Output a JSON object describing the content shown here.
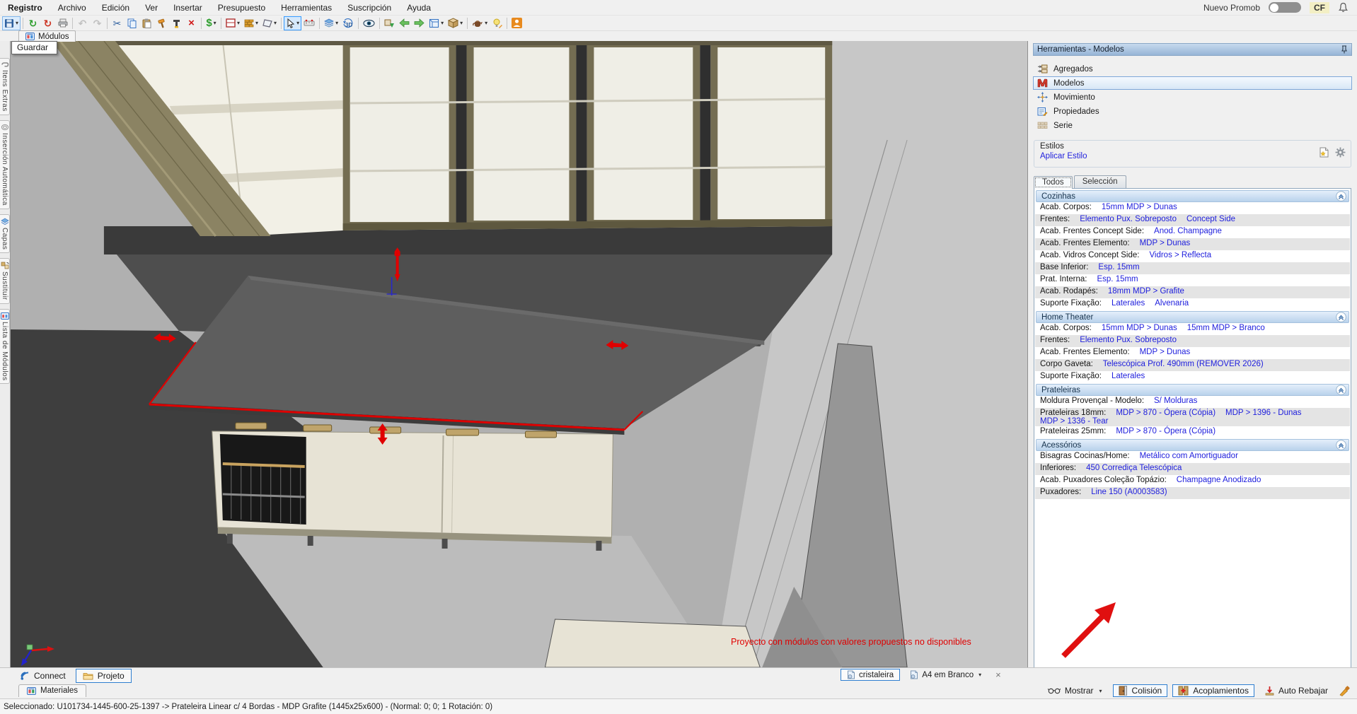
{
  "menu": {
    "items": [
      {
        "label": "Registro",
        "bold": true
      },
      {
        "label": "Archivo"
      },
      {
        "label": "Edición"
      },
      {
        "label": "Ver"
      },
      {
        "label": "Insertar"
      },
      {
        "label": "Presupuesto"
      },
      {
        "label": "Herramientas"
      },
      {
        "label": "Suscripción"
      },
      {
        "label": "Ayuda"
      }
    ],
    "right": {
      "toggle_label": "Nuevo Promob",
      "toggle_on": false,
      "badge": "CF"
    }
  },
  "toolbar": {
    "buttons": [
      {
        "icon": "save-icon",
        "name": "save",
        "dropdown": true,
        "hover": true
      },
      {
        "sep": true
      },
      {
        "icon": "sync-green-icon",
        "name": "sync-green"
      },
      {
        "icon": "sync-red-icon",
        "name": "sync-red"
      },
      {
        "icon": "printer-icon",
        "name": "print"
      },
      {
        "sep": true
      },
      {
        "icon": "undo-icon",
        "name": "undo",
        "disabled": true
      },
      {
        "icon": "redo-icon",
        "name": "redo",
        "disabled": true
      },
      {
        "sep": true
      },
      {
        "icon": "cut-icon",
        "name": "cut"
      },
      {
        "icon": "copy-icon",
        "name": "copy"
      },
      {
        "icon": "paste-icon",
        "name": "paste"
      },
      {
        "icon": "hammer-icon",
        "name": "build"
      },
      {
        "icon": "paint-icon",
        "name": "format-tool"
      },
      {
        "icon": "delete-icon",
        "name": "delete"
      },
      {
        "sep": true
      },
      {
        "icon": "budget-icon",
        "name": "budget",
        "dropdown": true
      },
      {
        "sep": true
      },
      {
        "icon": "panel-icon",
        "name": "environment",
        "dropdown": true
      },
      {
        "icon": "wall-icon",
        "name": "walls",
        "dropdown": true
      },
      {
        "icon": "shape-icon",
        "name": "shapes",
        "dropdown": true
      },
      {
        "sep": true
      },
      {
        "icon": "cursor-icon",
        "name": "select",
        "dropdown": true,
        "active": true
      },
      {
        "icon": "measure-icon",
        "name": "measure"
      },
      {
        "sep": true
      },
      {
        "icon": "layers-icon",
        "name": "layers",
        "dropdown": true
      },
      {
        "icon": "3d-icon",
        "name": "view-3d"
      },
      {
        "sep": true
      },
      {
        "icon": "eye-icon",
        "name": "visibility"
      },
      {
        "sep": true
      },
      {
        "icon": "module-arrow-icon",
        "name": "insert-module"
      },
      {
        "icon": "arrow-left-icon",
        "name": "nav-back"
      },
      {
        "icon": "arrow-right-icon",
        "name": "nav-forward"
      },
      {
        "icon": "room-icon",
        "name": "room-view",
        "dropdown": true
      },
      {
        "icon": "crate-icon",
        "name": "box-view",
        "dropdown": true
      },
      {
        "sep": true
      },
      {
        "icon": "teapot-icon",
        "name": "render",
        "dropdown": true
      },
      {
        "icon": "lamp-icon",
        "name": "lighting"
      },
      {
        "sep": true
      },
      {
        "icon": "person-icon",
        "name": "account"
      }
    ]
  },
  "top_tabs": {
    "modulos": "Módulos",
    "tooltip": "Guardar"
  },
  "left_sidebar": {
    "items": [
      {
        "label": "Itens Extras",
        "icon": "itens-extras-icon"
      },
      {
        "label": "Inserción Automática",
        "icon": "insercion-automatica-icon"
      },
      {
        "label": "Capas",
        "icon": "capas-icon"
      },
      {
        "label": "Sustituir",
        "icon": "sustituir-icon"
      },
      {
        "label": "Lista de Módulos",
        "icon": "lista-modulos-icon"
      }
    ]
  },
  "viewport": {
    "warning": "Proyecto con módulos con valores propuestos no disponibles"
  },
  "right_panel": {
    "title": "Herramientas - Modelos",
    "nav": [
      {
        "label": "Agregados",
        "icon": "aggregates-icon"
      },
      {
        "label": "Modelos",
        "icon": "models-icon",
        "selected": true
      },
      {
        "label": "Movimiento",
        "icon": "movement-icon"
      },
      {
        "label": "Propiedades",
        "icon": "properties-icon"
      },
      {
        "label": "Serie",
        "icon": "series-icon"
      }
    ],
    "styles": {
      "legend": "Estilos",
      "apply_link": "Aplicar Estilo"
    },
    "tabs": [
      {
        "label": "Todos",
        "active": true
      },
      {
        "label": "Selección",
        "active": false
      }
    ],
    "sections": [
      {
        "title": "Cozinhas",
        "rows": [
          {
            "label": "Acab. Corpos:",
            "values": [
              "15mm MDP > Dunas"
            ]
          },
          {
            "label": "Frentes:",
            "values": [
              "Elemento Pux. Sobreposto",
              "Concept Side"
            ]
          },
          {
            "label": "Acab. Frentes Concept Side:",
            "values": [
              "Anod. Champagne"
            ]
          },
          {
            "label": "Acab. Frentes Elemento:",
            "values": [
              "MDP > Dunas"
            ]
          },
          {
            "label": "Acab. Vidros Concept Side:",
            "values": [
              "Vidros > Reflecta"
            ]
          },
          {
            "label": "Base Inferior:",
            "values": [
              "Esp. 15mm"
            ]
          },
          {
            "label": "Prat. Interna:",
            "values": [
              "Esp. 15mm"
            ]
          },
          {
            "label": "Acab. Rodapés:",
            "values": [
              "18mm MDP > Grafite"
            ]
          },
          {
            "label": "Suporte Fixação:",
            "values": [
              "Laterales",
              "Alvenaria"
            ]
          }
        ]
      },
      {
        "title": "Home Theater",
        "rows": [
          {
            "label": "Acab. Corpos:",
            "values": [
              "15mm MDP > Dunas",
              "15mm MDP > Branco"
            ]
          },
          {
            "label": "Frentes:",
            "values": [
              "Elemento Pux. Sobreposto"
            ]
          },
          {
            "label": "Acab. Frentes Elemento:",
            "values": [
              "MDP > Dunas"
            ]
          },
          {
            "label": "Corpo Gaveta:",
            "values": [
              "Telescópica Prof. 490mm (REMOVER 2026)"
            ]
          },
          {
            "label": "Suporte Fixação:",
            "values": [
              "Laterales"
            ]
          }
        ]
      },
      {
        "title": "Prateleiras",
        "rows": [
          {
            "label": "Moldura Provençal - Modelo:",
            "values": [
              "S/ Molduras"
            ]
          },
          {
            "label": "Prateleiras 18mm:",
            "values": [
              "MDP > 870 - Ópera (Cópia)",
              "MDP > 1396 - Dunas",
              "MDP > 1336 - Tear"
            ]
          },
          {
            "label": "Prateleiras 25mm:",
            "values": [
              "MDP > 870 - Ópera (Cópia)"
            ]
          }
        ]
      },
      {
        "title": "Acessórios",
        "rows": [
          {
            "label": "Bisagras Cocinas/Home:",
            "values": [
              "Metálico com Amortiguador"
            ]
          },
          {
            "label": "Inferiores:",
            "values": [
              "450 Corrediça Telescópica"
            ]
          },
          {
            "label": "Acab. Puxadores Coleção Topázio:",
            "values": [
              "Champagne Anodizado"
            ]
          },
          {
            "label": "Puxadores:",
            "values": [
              "Line 150 (A0003583)"
            ]
          }
        ]
      }
    ]
  },
  "bottom": {
    "left_tabs": [
      {
        "label": "Connect",
        "icon": "connect-icon"
      },
      {
        "label": "Projeto",
        "icon": "folder-icon",
        "active": true
      }
    ],
    "materials_tab": {
      "label": "Materiales",
      "icon": "materials-icon"
    },
    "doc_tabs": [
      {
        "label": "cristaleira",
        "icon": "doc-icon",
        "active": true
      },
      {
        "label": "A4 em Branco",
        "icon": "doc-icon",
        "dropdown": true
      }
    ],
    "close_button": "×",
    "right_buttons": [
      {
        "label": "Mostrar",
        "icon": "glasses-icon",
        "dropdown": true
      },
      {
        "label": "Colisión",
        "icon": "door-icon",
        "toggled": true
      },
      {
        "label": "Acoplamientos",
        "icon": "joint-icon",
        "toggled": true
      },
      {
        "label": "Auto Rebajar",
        "icon": "auto-lower-icon"
      }
    ],
    "status": "Seleccionado: U101734-1445-600-25-1397 -> Prateleira Linear c/ 4 Bordas - MDP Grafite (1445x25x600) - (Normal: 0; 0; 1 Rotación: 0)"
  }
}
